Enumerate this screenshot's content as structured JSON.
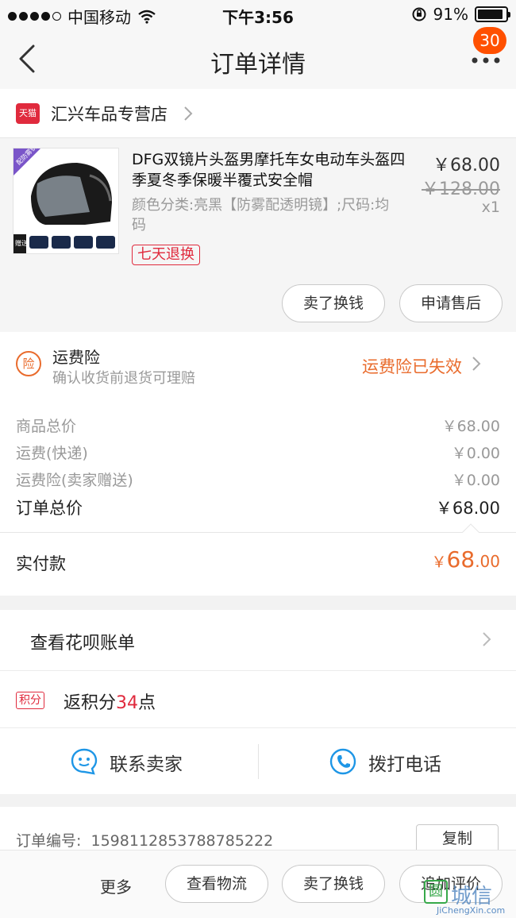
{
  "status_bar": {
    "carrier": "中国移动",
    "time": "下午3:56",
    "battery": "91%",
    "battery_level": 0.91
  },
  "nav": {
    "title": "订单详情",
    "badge_count": "30"
  },
  "shop": {
    "logo_text": "天猫",
    "name": "汇兴车品专营店"
  },
  "product": {
    "title": "DFG双镜片头盔男摩托车女电动车头盔四季夏冬季保暖半覆式安全帽",
    "sku": "颜色分类:亮黑【防雾配透明镜】;尺码:均码",
    "tag": "七天退换",
    "price": "￥68.00",
    "original_price": "￥128.00",
    "quantity": "x1",
    "thumb_banner": "配防雾镜片",
    "thumb_gift": "赠送",
    "buttons": {
      "sell": "卖了换钱",
      "after_sale": "申请售后"
    }
  },
  "insurance": {
    "icon_text": "险",
    "title": "运费险",
    "subtitle": "确认收货前退货可理赔",
    "status": "运费险已失效"
  },
  "prices": {
    "rows": [
      {
        "label": "商品总价",
        "value": "￥68.00"
      },
      {
        "label": "运费(快递)",
        "value": "￥0.00"
      },
      {
        "label": "运费险(卖家赠送)",
        "value": "￥0.00"
      }
    ],
    "total_label": "订单总价",
    "total_value": "￥68.00",
    "paid_label": "实付款",
    "paid_currency": "￥",
    "paid_int": "68",
    "paid_dec": ".00"
  },
  "huabei": {
    "label": "查看花呗账单"
  },
  "points": {
    "badge": "积分",
    "prefix": "返积分",
    "number": "34",
    "suffix": "点"
  },
  "contact": {
    "seller": "联系卖家",
    "phone": "拨打电话"
  },
  "order": {
    "label": "订单编号:",
    "number": "1598112853788785222",
    "copy": "复制"
  },
  "bottom_bar": {
    "more": "更多",
    "logistics": "查看物流",
    "sell": "卖了换钱",
    "review": "追加评价"
  },
  "watermark": {
    "mark": "圆",
    "cn": "城信",
    "url": "JiChengXin.com"
  },
  "colors": {
    "accent": "#ff5000",
    "orange": "#e96b2c",
    "tmall_red": "#e02a3d",
    "link_blue": "#1e96e6"
  }
}
